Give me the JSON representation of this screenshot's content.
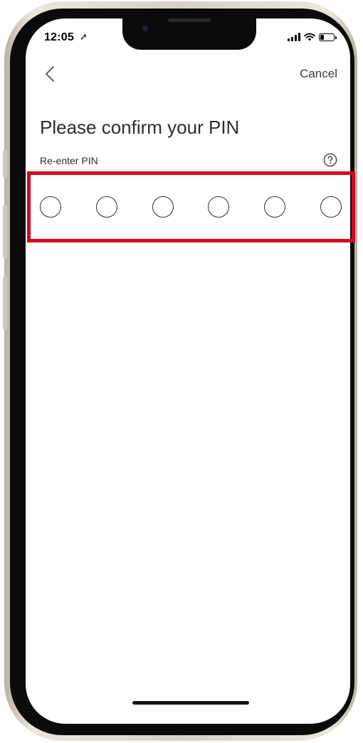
{
  "status_bar": {
    "time": "12:05",
    "location_glyph": "➚",
    "icons": [
      "signal-bars-icon",
      "wifi-icon",
      "battery-icon"
    ]
  },
  "nav": {
    "back_icon": "chevron-left-icon",
    "cancel_label": "Cancel"
  },
  "page": {
    "title": "Please confirm your PIN",
    "field_label": "Re-enter PIN",
    "help_icon": "question-circle-icon"
  },
  "pin": {
    "length": 6,
    "entered": 0
  },
  "colors": {
    "highlight": "#d3081f",
    "text": "#2e2e2e"
  }
}
